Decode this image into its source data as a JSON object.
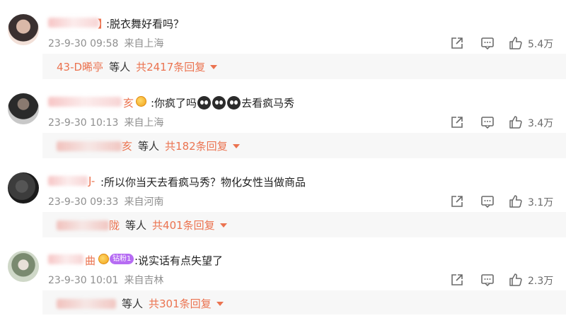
{
  "comments": [
    {
      "name_tail": "】",
      "text": ":脱衣舞好看吗？",
      "date": "23-9-30 09:58",
      "location": "来自上海",
      "likes": "5.4万",
      "replies": {
        "user": "43-D晞亭",
        "wait_label": "等人",
        "count_label": "共2417条回复"
      },
      "avatar_colors": [
        "#f2e0d8",
        "#3a3030",
        "#c9a898"
      ]
    },
    {
      "name_tail": "亥",
      "text": ":你疯了吗",
      "text_after": "去看疯马秀",
      "emoji_icons": [
        "crying-face-icon",
        "crying-face-icon",
        "crying-face-icon"
      ],
      "date": "23-9-30 10:13",
      "location": "来自上海",
      "likes": "3.4万",
      "replies": {
        "user_tail": "亥",
        "wait_label": "等人",
        "count_label": "共182条回复"
      },
      "avatar_colors": [
        "#c8c8c8",
        "#2a2a2a",
        "#8a7a70"
      ]
    },
    {
      "name_tail": "J-",
      "text": ":所以你当天去看疯马秀？物化女性当做商品",
      "date": "23-9-30 09:33",
      "location": "来自河南",
      "likes": "3.1万",
      "replies": {
        "user_tail": "陇",
        "wait_label": "等人",
        "count_label": "共401条回复"
      },
      "avatar_colors": [
        "#1a1a1a",
        "#3c3c3c",
        "#555555"
      ]
    },
    {
      "name_tail": "曲",
      "fan_badge": "钻粉1",
      "text": ":说实话有点失望了",
      "date": "23-9-30 10:01",
      "location": "来自吉林",
      "likes": "2.3万",
      "replies": {
        "wait_label": "等人",
        "count_label": "共301条回复"
      },
      "avatar_colors": [
        "#cfd8c8",
        "#7a8a70",
        "#e8e0d8"
      ]
    }
  ],
  "colors": {
    "accent": "#eb7350",
    "meta_gray": "#8f8f8f",
    "reply_bg": "#f7f7f7",
    "fan_badge": "#b66cf3"
  },
  "icons": {
    "share": "share-icon",
    "comment": "comment-icon",
    "like": "thumbs-up-icon",
    "expand": "caret-down-icon"
  }
}
